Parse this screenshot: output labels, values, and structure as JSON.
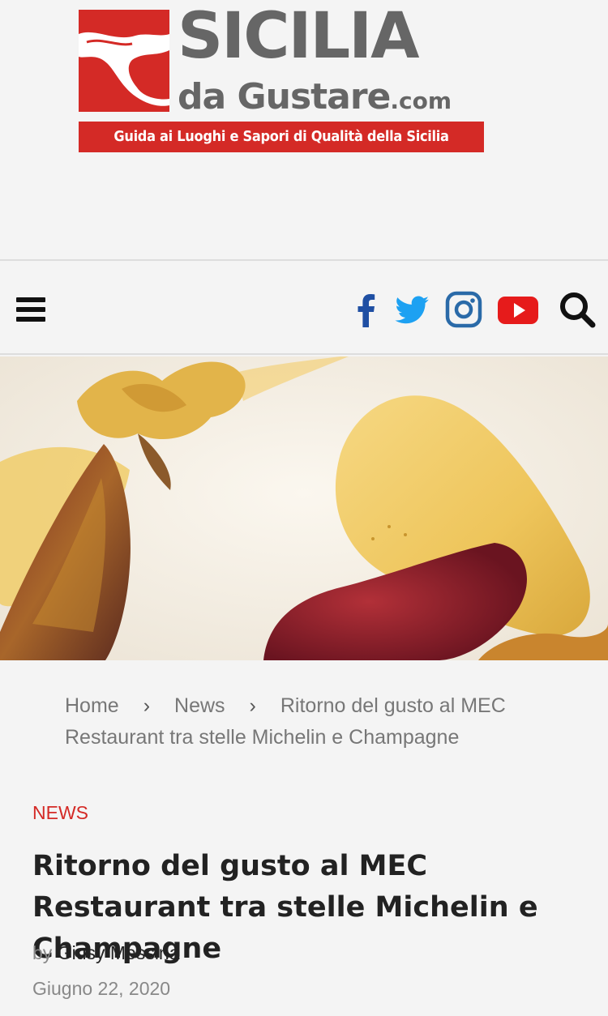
{
  "logo": {
    "line1": "SICILIA",
    "line2": "da Gustare",
    "line2_suffix": ".com",
    "tagline": "Guida ai Luoghi e Sapori di Qualità della Sicilia"
  },
  "nav": {
    "icons": [
      "menu-icon",
      "facebook-icon",
      "twitter-icon",
      "instagram-icon",
      "youtube-icon",
      "search-icon"
    ]
  },
  "breadcrumb": {
    "items": [
      "Home",
      "News",
      "Ritorno del gusto al MEC Restaurant tra stelle Michelin e Champagne"
    ],
    "separator": "›"
  },
  "article": {
    "category": "NEWS",
    "title": "Ritorno del gusto al MEC Restaurant tra stelle Michelin e Champagne",
    "by_label": "by",
    "author": "Giusy Messina",
    "date": "Giugno 22, 2020"
  },
  "colors": {
    "brand_red": "#d42a26",
    "logo_gray": "#666666",
    "facebook": "#1f4fa3",
    "twitter": "#1da1f2",
    "instagram": "#2a6aa8",
    "youtube": "#e61b1b"
  }
}
